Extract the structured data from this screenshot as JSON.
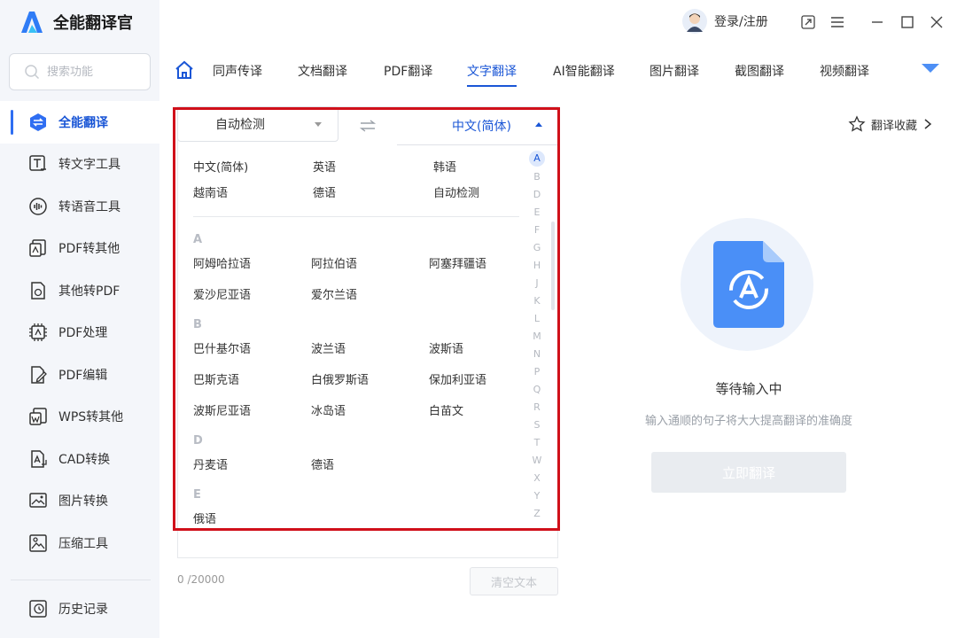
{
  "app": {
    "title": "全能翻译官"
  },
  "search": {
    "placeholder": "搜索功能"
  },
  "sidebar": {
    "items": [
      {
        "label": "全能翻译"
      },
      {
        "label": "转文字工具"
      },
      {
        "label": "转语音工具"
      },
      {
        "label": "PDF转其他"
      },
      {
        "label": "其他转PDF"
      },
      {
        "label": "PDF处理"
      },
      {
        "label": "PDF编辑"
      },
      {
        "label": "WPS转其他"
      },
      {
        "label": "CAD转换"
      },
      {
        "label": "图片转换"
      },
      {
        "label": "压缩工具"
      }
    ],
    "history": "历史记录"
  },
  "titlebar": {
    "login": "登录/注册"
  },
  "tabs": [
    {
      "label": "同声传译"
    },
    {
      "label": "文档翻译"
    },
    {
      "label": "PDF翻译"
    },
    {
      "label": "文字翻译"
    },
    {
      "label": "AI智能翻译"
    },
    {
      "label": "图片翻译"
    },
    {
      "label": "截图翻译"
    },
    {
      "label": "视频翻译"
    }
  ],
  "translator": {
    "source_lang": "自动检测",
    "target_lang": "中文(简体)",
    "common": [
      "中文(简体)",
      "英语",
      "韩语",
      "越南语",
      "德语",
      "自动检测"
    ],
    "groups": [
      {
        "letter": "A",
        "langs": [
          "阿姆哈拉语",
          "阿拉伯语",
          "阿塞拜疆语",
          "爱沙尼亚语",
          "爱尔兰语"
        ]
      },
      {
        "letter": "B",
        "langs": [
          "巴什基尔语",
          "波兰语",
          "波斯语",
          "巴斯克语",
          "白俄罗斯语",
          "保加利亚语",
          "波斯尼亚语",
          "冰岛语",
          "白苗文"
        ]
      },
      {
        "letter": "D",
        "langs": [
          "丹麦语",
          "德语"
        ]
      },
      {
        "letter": "E",
        "langs": [
          "俄语"
        ]
      }
    ],
    "alphabet": [
      "A",
      "B",
      "D",
      "E",
      "F",
      "G",
      "H",
      "J",
      "K",
      "L",
      "M",
      "N",
      "P",
      "Q",
      "R",
      "S",
      "T",
      "W",
      "X",
      "Y",
      "Z"
    ],
    "counter": "0 /20000",
    "clear": "清空文本"
  },
  "result": {
    "favorites": "翻译收藏",
    "waiting_title": "等待输入中",
    "waiting_desc": "输入通顺的句子将大大提高翻译的准确度",
    "translate_btn": "立即翻译"
  },
  "colors": {
    "accent": "#1a56d6",
    "highlight": "#d0101a"
  }
}
